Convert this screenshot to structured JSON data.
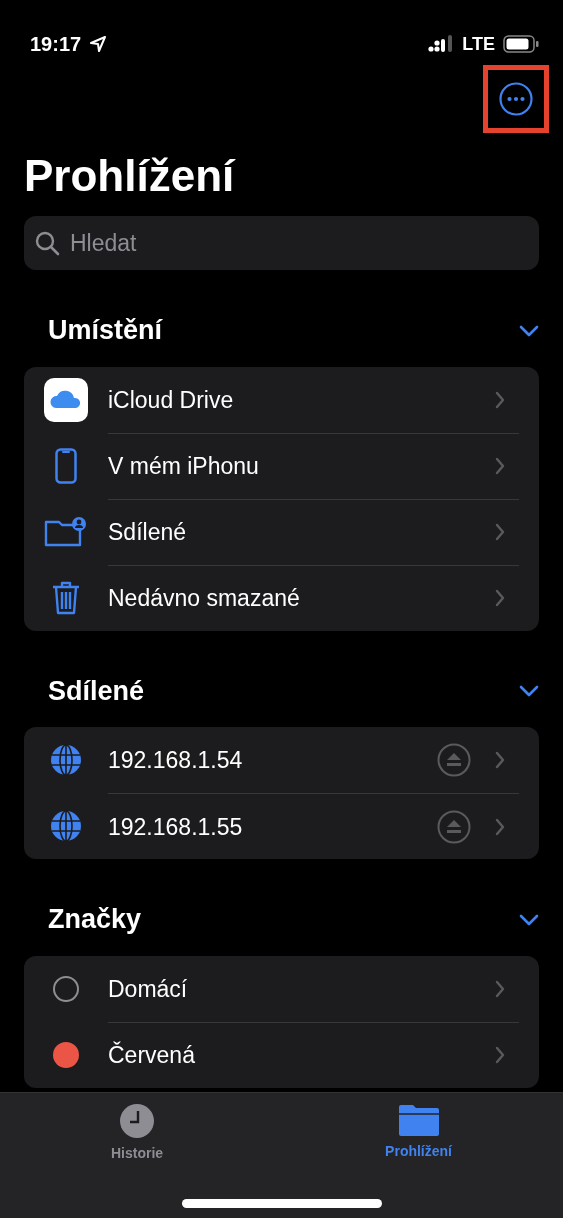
{
  "status_bar": {
    "time": "19:17",
    "network": "LTE"
  },
  "more_button": {
    "highlighted": true
  },
  "title": "Prohlížení",
  "search": {
    "placeholder": "Hledat"
  },
  "sections": [
    {
      "title": "Umístění",
      "expanded": true,
      "items": [
        {
          "kind": "icloud",
          "label": "iCloud Drive"
        },
        {
          "kind": "iphone",
          "label": "V mém iPhonu"
        },
        {
          "kind": "shared",
          "label": "Sdílené"
        },
        {
          "kind": "trash",
          "label": "Nedávno smazané"
        }
      ]
    },
    {
      "title": "Sdílené",
      "expanded": true,
      "items": [
        {
          "kind": "server",
          "label": "192.168.1.54"
        },
        {
          "kind": "server",
          "label": "192.168.1.55"
        }
      ]
    },
    {
      "title": "Značky",
      "expanded": true,
      "items": [
        {
          "kind": "tag",
          "label": "Domácí"
        },
        {
          "kind": "tag",
          "label": "Červená",
          "color": "#eb5545"
        }
      ]
    }
  ],
  "tabs": [
    {
      "label": "Historie",
      "kind": "history",
      "selected": false
    },
    {
      "label": "Prohlížení",
      "kind": "browse",
      "selected": true
    }
  ]
}
